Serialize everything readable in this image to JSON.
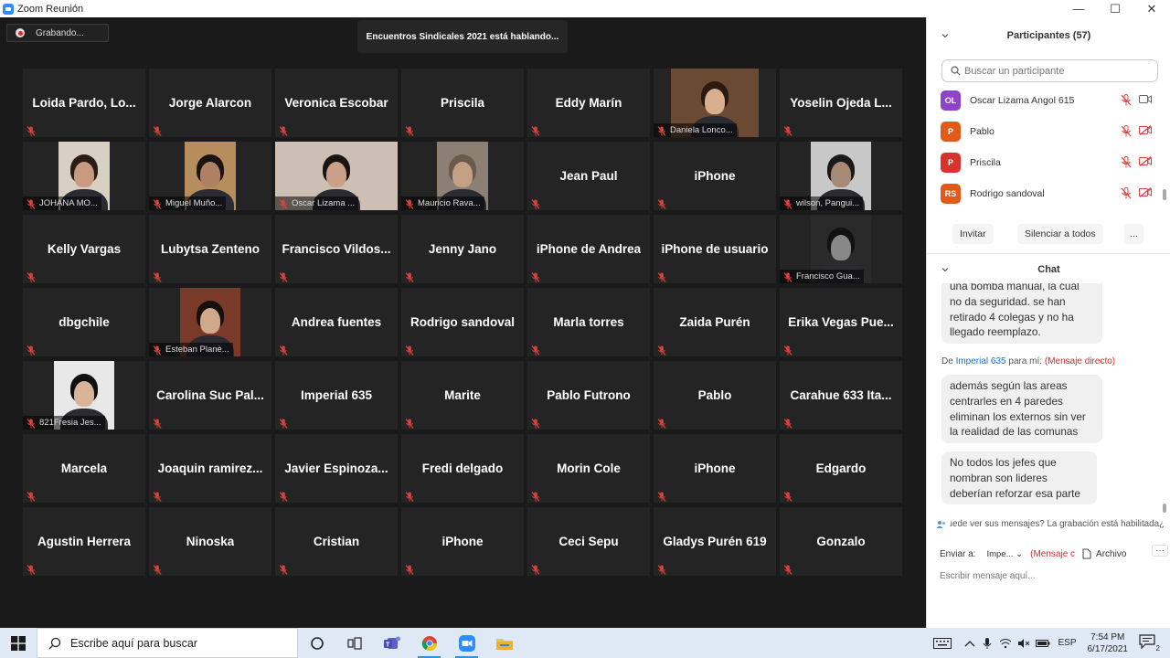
{
  "window": {
    "title": "Zoom Reunión",
    "controls": [
      "—",
      "☐",
      "✕"
    ]
  },
  "meeting": {
    "recording_label": "Grabando...",
    "speaking_banner": "Encuentros Sindicales 2021 está hablando...",
    "tiles": [
      {
        "name": "Loida Pardo, Lo...",
        "video": false
      },
      {
        "name": "Jorge Alarcon",
        "video": false
      },
      {
        "name": "Veronica Escobar",
        "video": false
      },
      {
        "name": "Priscila",
        "video": false
      },
      {
        "name": "Eddy Marín",
        "video": false
      },
      {
        "name": "Daniela Lonco...",
        "video": true,
        "bg": "#6b4a33",
        "skin": "#d8b08e",
        "hair": "#2a1a12"
      },
      {
        "name": "Yoselin Ojeda L...",
        "video": false
      },
      {
        "name": "JOHANA MO...",
        "video": true,
        "bg": "#d9d0c4",
        "skin": "#c89a80",
        "hair": "#2b1c14"
      },
      {
        "name": "Miguel Muño...",
        "video": true,
        "bg": "#b88d5e",
        "skin": "#b08065",
        "hair": "#1a1410"
      },
      {
        "name": "Oscar Lizama ...",
        "video": true,
        "bg": "#cdbfb4",
        "skin": "#caa088",
        "hair": "#1b1512"
      },
      {
        "name": "Mauricio Rava...",
        "video": true,
        "bg": "#8c7f73",
        "skin": "#c4a085",
        "hair": "#6a5a4c"
      },
      {
        "name": "Jean Paul",
        "video": false
      },
      {
        "name": "iPhone",
        "video": false
      },
      {
        "name": "wilson, Pangui...",
        "video": true,
        "bg": "#c8c8c8",
        "skin": "#a68a76",
        "hair": "#1a1a1a"
      },
      {
        "name": "Kelly Vargas",
        "video": false
      },
      {
        "name": "Lubytsa Zenteno",
        "video": false
      },
      {
        "name": "Francisco  Vildos...",
        "video": false
      },
      {
        "name": "Jenny Jano",
        "video": false
      },
      {
        "name": "iPhone de Andrea",
        "video": false
      },
      {
        "name": "iPhone de usuario",
        "video": false
      },
      {
        "name": "Francisco Gua...",
        "video": true,
        "bg": "#2a2a2a",
        "skin": "#888888",
        "hair": "#111111"
      },
      {
        "name": "dbgchile",
        "video": false
      },
      {
        "name": "Esteban Planè...",
        "video": true,
        "bg": "#7a3a2a",
        "skin": "#d0a98c",
        "hair": "#151010"
      },
      {
        "name": "Andrea fuentes",
        "video": false
      },
      {
        "name": "Rodrigo sandoval",
        "video": false
      },
      {
        "name": "Marla torres",
        "video": false
      },
      {
        "name": "Zaida Purén",
        "video": false
      },
      {
        "name": "Erika Vegas Pue...",
        "video": false
      },
      {
        "name": "821Fresia Jes...",
        "video": true,
        "bg": "#e8e8e8",
        "skin": "#d8b49a",
        "hair": "#0f0f0f"
      },
      {
        "name": "Carolina Suc Pal...",
        "video": false
      },
      {
        "name": "Imperial 635",
        "video": false
      },
      {
        "name": "Marite",
        "video": false
      },
      {
        "name": "Pablo Futrono",
        "video": false
      },
      {
        "name": "Pablo",
        "video": false
      },
      {
        "name": "Carahue 633 Ita...",
        "video": false
      },
      {
        "name": "Marcela",
        "video": false
      },
      {
        "name": "Joaquin  ramirez...",
        "video": false
      },
      {
        "name": "Javier  Espinoza...",
        "video": false
      },
      {
        "name": "Fredi delgado",
        "video": false
      },
      {
        "name": "Morin Cole",
        "video": false
      },
      {
        "name": "iPhone",
        "video": false
      },
      {
        "name": "Edgardo",
        "video": false
      },
      {
        "name": "Agustin Herrera",
        "video": false
      },
      {
        "name": "Ninoska",
        "video": false
      },
      {
        "name": "Cristian",
        "video": false
      },
      {
        "name": "iPhone",
        "video": false
      },
      {
        "name": "Ceci Sepu",
        "video": false
      },
      {
        "name": "Gladys Purén 619",
        "video": false
      },
      {
        "name": "Gonzalo",
        "video": false
      }
    ]
  },
  "participants": {
    "header": "Participantes (57)",
    "search_placeholder": "Buscar un participante",
    "items": [
      {
        "initials": "OL",
        "name": "Oscar Lizama Angol 615",
        "color": "#8e44c9",
        "video_on": true
      },
      {
        "initials": "P",
        "name": "Pablo",
        "color": "#e05a1a",
        "video_on": false
      },
      {
        "initials": "P",
        "name": "Priscila",
        "color": "#d6322e",
        "video_on": false
      },
      {
        "initials": "RS",
        "name": "Rodrigo sandoval",
        "color": "#e05a1a",
        "video_on": false
      }
    ],
    "buttons": {
      "invite": "Invitar",
      "mute_all": "Silenciar a todos",
      "more": "..."
    }
  },
  "chat": {
    "header": "Chat",
    "msg1": [
      "una bomba manual, la cual",
      "no da seguridad. se han",
      "retirado 4  colegas  y no ha",
      "llegado reemplazo."
    ],
    "dm_prefix": "De",
    "dm_from": "Imperial 635",
    "dm_to": "para mí:",
    "dm_tag": "(Mensaje directo)",
    "msg2": [
      "además según las areas",
      "centrarles en 4  paredes",
      "eliminan los externos sin ver",
      "la realidad de las comunas"
    ],
    "msg3": [
      "No todos los jefes que",
      "nombran son lideres",
      "deberían reforzar esa parte"
    ],
    "notice": "¿Quién puede ver sus mensajes? La grabación está habilitada",
    "send_to_label": "Enviar a:",
    "send_to_value": "Impe...",
    "send_to_tag": "(Mensaje c",
    "file_label": "Archivo",
    "more": "···",
    "input_placeholder": "Escribir mensaje aquí..."
  },
  "taskbar": {
    "search_placeholder": "Escribe aquí para buscar",
    "time": "7:54 PM",
    "date": "6/17/2021",
    "lang": "ESP",
    "notifications": "2"
  }
}
